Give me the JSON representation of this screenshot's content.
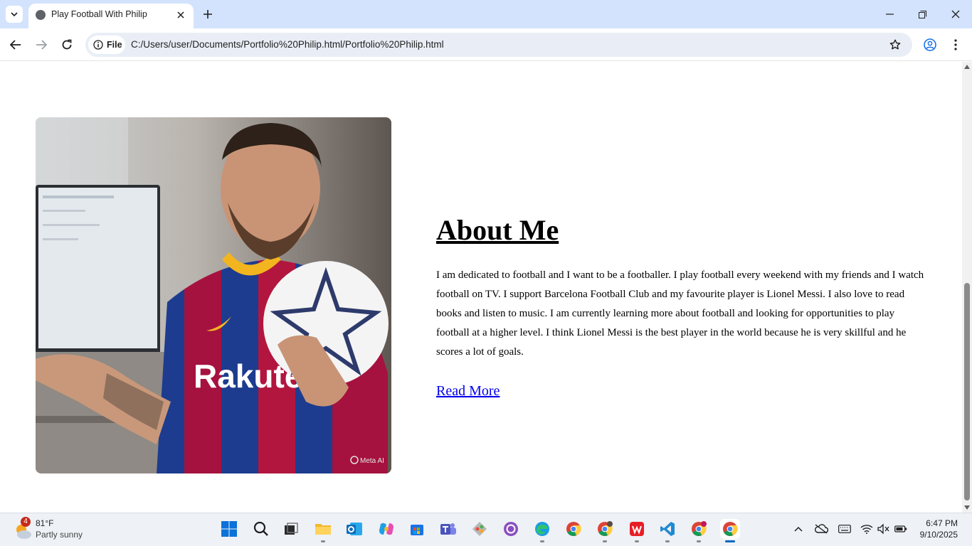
{
  "browser": {
    "tab_title": "Play Football With Philip",
    "chip_label": "File",
    "url": "C:/Users/user/Documents/Portfolio%20Philip.html/Portfolio%20Philip.html"
  },
  "page": {
    "heading": "About Me",
    "paragraph": "I am dedicated to football and I want to be a footballer. I play football every weekend with my friends and I watch football on TV. I support Barcelona Football Club and my favourite player is Lionel Messi. I also love to read books and listen to music. I am currently learning more about football and looking for opportunities to play football at a higher level. I think Lionel Messi is the best player in the world because he is very skillful and he scores a lot of goals.",
    "link": "Read More",
    "photo": {
      "shirt_text": "Rakuten",
      "watermark": "Meta AI"
    }
  },
  "taskbar": {
    "weather_badge": "4",
    "weather_temp": "81°F",
    "weather_desc": "Partly sunny",
    "time": "6:47 PM",
    "date": "9/10/2025"
  },
  "colors": {
    "tabbar": "#d3e3fd",
    "link": "#0000ee",
    "taskbar": "#eef1f6"
  }
}
